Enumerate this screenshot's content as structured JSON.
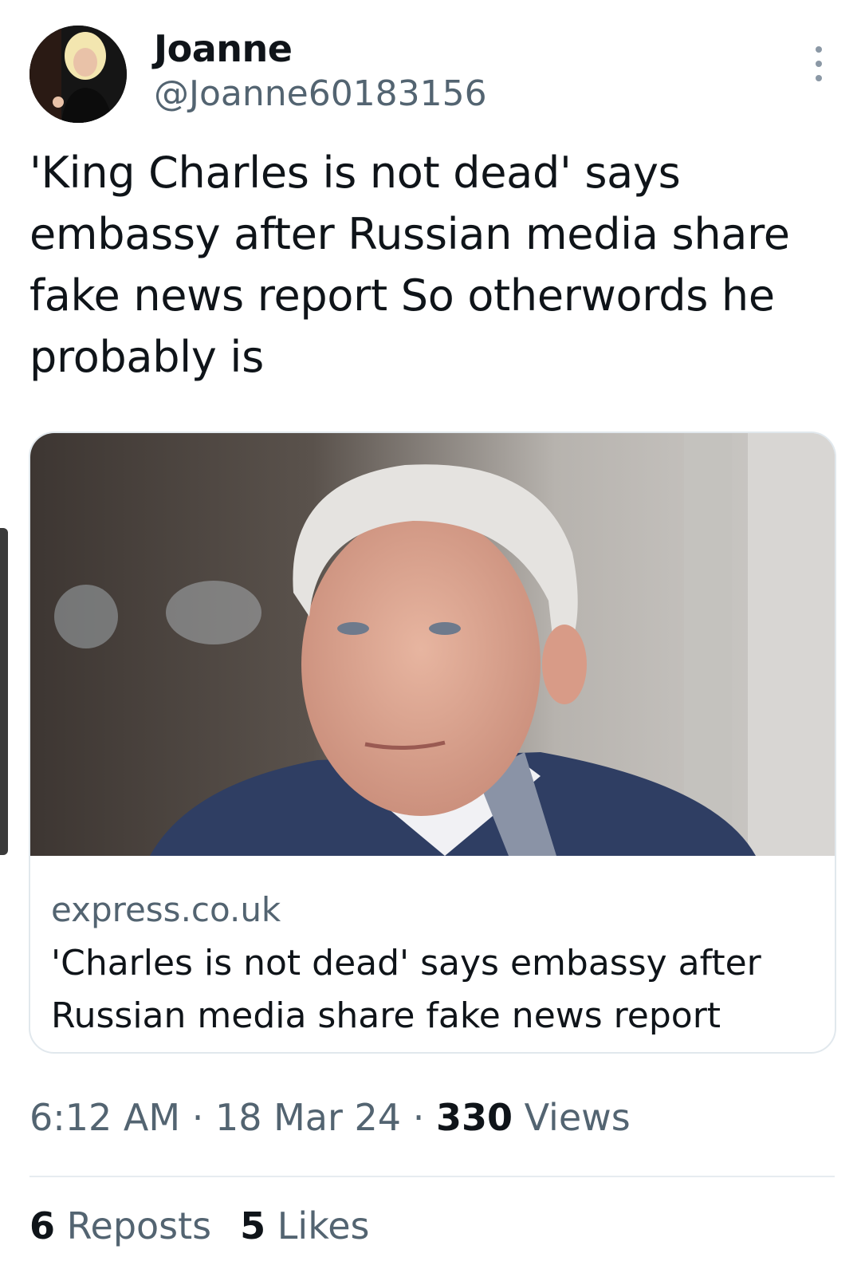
{
  "author": {
    "display_name": "Joanne",
    "handle": "@Joanne60183156",
    "avatar_icon": "profile-photo-avatar"
  },
  "tweet": {
    "text": "'King Charles is not dead' says embassy after Russian media share fake news report So otherwords he probably is"
  },
  "link_card": {
    "image_icon": "news-photo-elderly-man-portrait",
    "domain": "express.co.uk",
    "title": "'Charles is not dead' says embassy after Russian media share fake news report"
  },
  "meta": {
    "time": "6:12 AM",
    "separator": "·",
    "date": "18 Mar 24",
    "views_count": "330",
    "views_label": "Views"
  },
  "stats": {
    "reposts_count": "6",
    "reposts_label": "Reposts",
    "likes_count": "5",
    "likes_label": "Likes"
  },
  "more_icon": "more-vertical-icon",
  "colors": {
    "text_primary": "#0f1419",
    "text_secondary": "#536471",
    "border": "#e1e8ed"
  }
}
